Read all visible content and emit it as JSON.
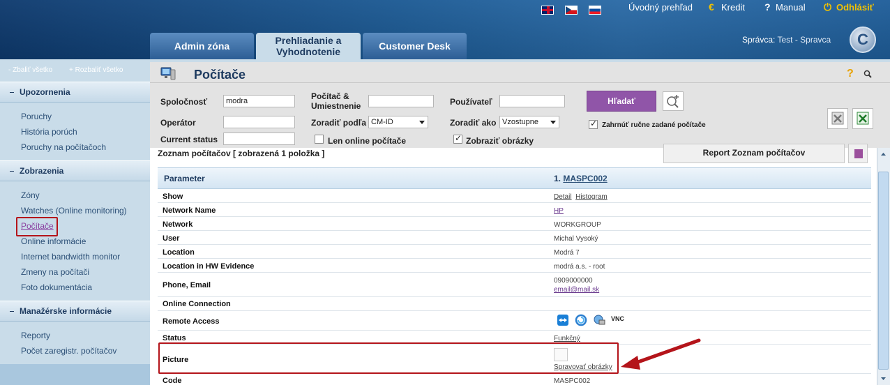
{
  "header": {
    "links": {
      "overview": "Úvodný prehľad",
      "credit": "Kredit",
      "manual": "Manual",
      "logout": "Odhlásiť"
    },
    "tabs": {
      "admin": "Admin zóna",
      "review_line1": "Prehliadanie a",
      "review_line2": "Vyhodnotenie",
      "customer": "Customer Desk"
    },
    "admin_label": "Správca:",
    "admin_name": "Test - Spravca",
    "logo_letter": "C"
  },
  "sidebar": {
    "collapse_all": "- Zbaliť všetko",
    "expand_all": "+ Rozbaliť všetko",
    "sections": [
      {
        "title": "Upozornenia",
        "items": [
          "Poruchy",
          "História porúch",
          "Poruchy na počítačoch"
        ]
      },
      {
        "title": "Zobrazenia",
        "items": [
          "Zóny",
          "Watches (Online monitoring)",
          "Počítače",
          "Online informácie",
          "Internet bandwidth monitor",
          "Zmeny na počítači",
          "Foto dokumentácia"
        ]
      },
      {
        "title": "Manažérske informácie",
        "items": [
          "Reporty",
          "Počet zaregistr. počítačov"
        ]
      }
    ]
  },
  "page": {
    "title": "Počítače",
    "help": "?"
  },
  "filters": {
    "company_label": "Spoločnosť",
    "company_value": "modra",
    "computer_label_1": "Počítač &",
    "computer_label_2": "Umiestnenie",
    "computer_value": "",
    "user_label": "Používateľ",
    "user_value": "",
    "operator_label": "Operátor",
    "operator_value": "",
    "sort_by_label": "Zoradiť podľa",
    "sort_by_value": "CM-ID",
    "sort_as_label": "Zoradiť ako",
    "sort_as_value": "Vzostupne",
    "status_label": "Current status",
    "status_value": "",
    "online_only": "Len online počítače",
    "show_images": "Zobraziť obrázky",
    "include_manual": "Zahrnúť ručne zadané počítače",
    "search_button": "Hľadať"
  },
  "list": {
    "title_prefix": "Zoznam počítačov [ zobrazená ",
    "count": "1",
    "title_suffix": " položka ]",
    "report_button": "Report Zoznam počítačov"
  },
  "table": {
    "header_param": "Parameter",
    "header_num": "1.",
    "header_computer": "MASPC002",
    "rows": {
      "show_label": "Show",
      "show_detail": "Detail",
      "show_histogram": "Histogram",
      "network_name_label": "Network Name",
      "network_name_value": "HP",
      "network_label": "Network",
      "network_value": "WORKGROUP",
      "user_label": "User",
      "user_value": "Michal Vysoký",
      "location_label": "Location",
      "location_value": "Modrá 7",
      "hw_location_label": "Location in HW Evidence",
      "hw_location_value": "modrá a.s. - root",
      "phone_label": "Phone, Email",
      "phone_value": "0909000000",
      "email_value": "email@mail.sk",
      "online_label": "Online Connection",
      "remote_label": "Remote Access",
      "vnc": "VNC",
      "status_label": "Status",
      "status_value": "Funkčný",
      "picture_label": "Picture",
      "picture_link": "Spravovať obrázky",
      "code_label": "Code",
      "code_value": "MASPC002"
    }
  },
  "colors": {
    "header_blue": "#1c5a94",
    "search_button": "#9055a8",
    "highlight_red": "#b4141a",
    "sidebar_bg": "#c9dce9"
  }
}
